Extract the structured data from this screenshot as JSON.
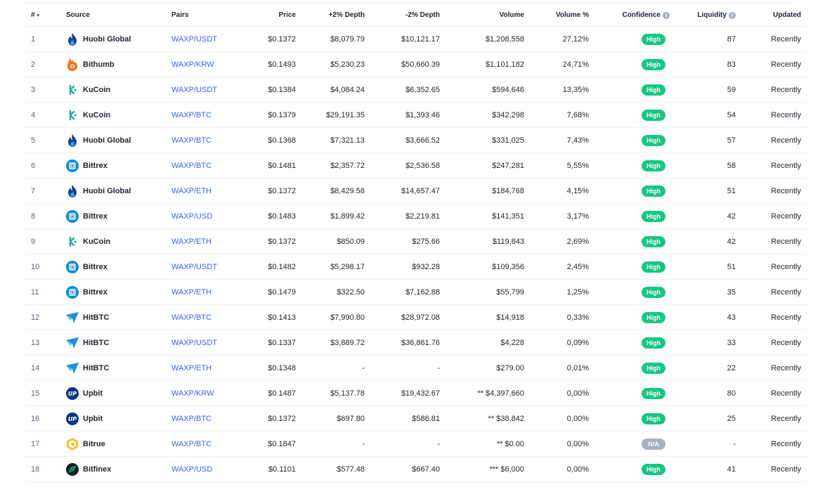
{
  "header": {
    "num": "#",
    "source": "Source",
    "pairs": "Pairs",
    "price": "Price",
    "plus_depth": "+2% Depth",
    "minus_depth": "-2% Depth",
    "volume": "Volume",
    "volume_pct": "Volume %",
    "confidence": "Confidence",
    "liquidity": "Liquidity",
    "updated": "Updated"
  },
  "colors": {
    "high": "#16c784",
    "na": "#a6b0c3",
    "link": "#3861fb"
  },
  "rows": [
    {
      "num": "1",
      "source": "Huobi Global",
      "icon": "huobi-icon",
      "pair": "WAXP/USDT",
      "price": "$0.1372",
      "plus_depth": "$8,079.79",
      "minus_depth": "$10,121.17",
      "volume": "$1,208,558",
      "volume_pct": "27,12%",
      "confidence": "High",
      "liquidity": "87",
      "updated": "Recently"
    },
    {
      "num": "2",
      "source": "Bithumb",
      "icon": "bithumb-icon",
      "pair": "WAXP/KRW",
      "price": "$0.1493",
      "plus_depth": "$5,230.23",
      "minus_depth": "$50,660.39",
      "volume": "$1,101,182",
      "volume_pct": "24,71%",
      "confidence": "High",
      "liquidity": "83",
      "updated": "Recently"
    },
    {
      "num": "3",
      "source": "KuCoin",
      "icon": "kucoin-icon",
      "pair": "WAXP/USDT",
      "price": "$0.1384",
      "plus_depth": "$4,084.24",
      "minus_depth": "$6,352.65",
      "volume": "$594,646",
      "volume_pct": "13,35%",
      "confidence": "High",
      "liquidity": "59",
      "updated": "Recently"
    },
    {
      "num": "4",
      "source": "KuCoin",
      "icon": "kucoin-icon",
      "pair": "WAXP/BTC",
      "price": "$0.1379",
      "plus_depth": "$29,191.35",
      "minus_depth": "$1,393.46",
      "volume": "$342,298",
      "volume_pct": "7,68%",
      "confidence": "High",
      "liquidity": "54",
      "updated": "Recently"
    },
    {
      "num": "5",
      "source": "Huobi Global",
      "icon": "huobi-icon",
      "pair": "WAXP/BTC",
      "price": "$0.1368",
      "plus_depth": "$7,321.13",
      "minus_depth": "$3,666.52",
      "volume": "$331,025",
      "volume_pct": "7,43%",
      "confidence": "High",
      "liquidity": "57",
      "updated": "Recently"
    },
    {
      "num": "6",
      "source": "Bittrex",
      "icon": "bittrex-icon",
      "pair": "WAXP/BTC",
      "price": "$0.1481",
      "plus_depth": "$2,357.72",
      "minus_depth": "$2,536.58",
      "volume": "$247,281",
      "volume_pct": "5,55%",
      "confidence": "High",
      "liquidity": "58",
      "updated": "Recently"
    },
    {
      "num": "7",
      "source": "Huobi Global",
      "icon": "huobi-icon",
      "pair": "WAXP/ETH",
      "price": "$0.1372",
      "plus_depth": "$8,429.58",
      "minus_depth": "$14,657.47",
      "volume": "$184,768",
      "volume_pct": "4,15%",
      "confidence": "High",
      "liquidity": "51",
      "updated": "Recently"
    },
    {
      "num": "8",
      "source": "Bittrex",
      "icon": "bittrex-icon",
      "pair": "WAXP/USD",
      "price": "$0.1483",
      "plus_depth": "$1,899.42",
      "minus_depth": "$2,219.81",
      "volume": "$141,351",
      "volume_pct": "3,17%",
      "confidence": "High",
      "liquidity": "42",
      "updated": "Recently"
    },
    {
      "num": "9",
      "source": "KuCoin",
      "icon": "kucoin-icon",
      "pair": "WAXP/ETH",
      "price": "$0.1372",
      "plus_depth": "$850.09",
      "minus_depth": "$275.66",
      "volume": "$119,843",
      "volume_pct": "2,69%",
      "confidence": "High",
      "liquidity": "42",
      "updated": "Recently"
    },
    {
      "num": "10",
      "source": "Bittrex",
      "icon": "bittrex-icon",
      "pair": "WAXP/USDT",
      "price": "$0.1482",
      "plus_depth": "$5,298.17",
      "minus_depth": "$932.28",
      "volume": "$109,356",
      "volume_pct": "2,45%",
      "confidence": "High",
      "liquidity": "51",
      "updated": "Recently"
    },
    {
      "num": "11",
      "source": "Bittrex",
      "icon": "bittrex-icon",
      "pair": "WAXP/ETH",
      "price": "$0.1479",
      "plus_depth": "$322.50",
      "minus_depth": "$7,162.88",
      "volume": "$55,799",
      "volume_pct": "1,25%",
      "confidence": "High",
      "liquidity": "35",
      "updated": "Recently"
    },
    {
      "num": "12",
      "source": "HitBTC",
      "icon": "hitbtc-icon",
      "pair": "WAXP/BTC",
      "price": "$0.1413",
      "plus_depth": "$7,990.80",
      "minus_depth": "$28,972.08",
      "volume": "$14,918",
      "volume_pct": "0,33%",
      "confidence": "High",
      "liquidity": "43",
      "updated": "Recently"
    },
    {
      "num": "13",
      "source": "HitBTC",
      "icon": "hitbtc-icon",
      "pair": "WAXP/USDT",
      "price": "$0.1337",
      "plus_depth": "$3,889.72",
      "minus_depth": "$36,861.76",
      "volume": "$4,228",
      "volume_pct": "0,09%",
      "confidence": "High",
      "liquidity": "33",
      "updated": "Recently"
    },
    {
      "num": "14",
      "source": "HitBTC",
      "icon": "hitbtc-icon",
      "pair": "WAXP/ETH",
      "price": "$0.1348",
      "plus_depth": "-",
      "minus_depth": "-",
      "volume": "$279.00",
      "volume_pct": "0,01%",
      "confidence": "High",
      "liquidity": "22",
      "updated": "Recently"
    },
    {
      "num": "15",
      "source": "Upbit",
      "icon": "upbit-icon",
      "pair": "WAXP/KRW",
      "price": "$0.1487",
      "plus_depth": "$5,137.78",
      "minus_depth": "$19,432.67",
      "volume": "** $4,397,660",
      "volume_pct": "0,00%",
      "confidence": "High",
      "liquidity": "80",
      "updated": "Recently"
    },
    {
      "num": "16",
      "source": "Upbit",
      "icon": "upbit-icon",
      "pair": "WAXP/BTC",
      "price": "$0.1372",
      "plus_depth": "$697.80",
      "minus_depth": "$586.81",
      "volume": "** $38,842",
      "volume_pct": "0,00%",
      "confidence": "High",
      "liquidity": "25",
      "updated": "Recently"
    },
    {
      "num": "17",
      "source": "Bitrue",
      "icon": "bitrue-icon",
      "pair": "WAXP/BTC",
      "price": "$0.1847",
      "plus_depth": "-",
      "minus_depth": "-",
      "volume": "** $0.00",
      "volume_pct": "0,00%",
      "confidence": "N/A",
      "liquidity": "-",
      "updated": "Recently"
    },
    {
      "num": "18",
      "source": "Bitfinex",
      "icon": "bitfinex-icon",
      "pair": "WAXP/USD",
      "price": "$0.1101",
      "plus_depth": "$577.48",
      "minus_depth": "$667.40",
      "volume": "*** $6,000",
      "volume_pct": "0,00%",
      "confidence": "High",
      "liquidity": "41",
      "updated": "Recently"
    }
  ]
}
